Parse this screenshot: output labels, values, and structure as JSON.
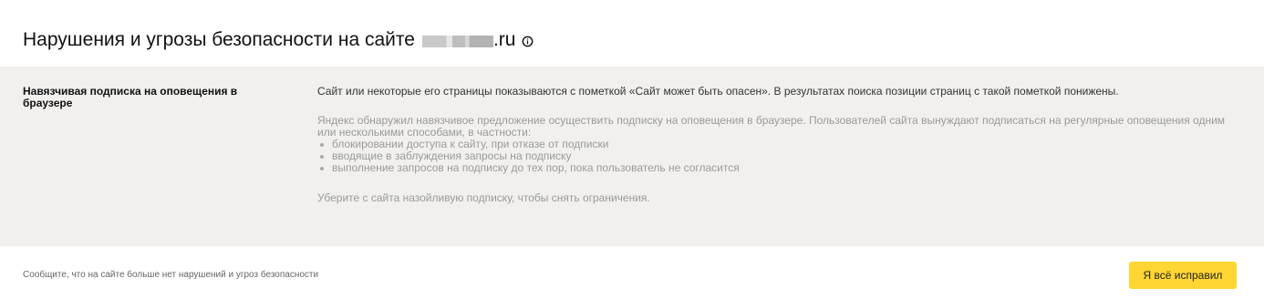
{
  "header": {
    "title_prefix": "Нарушения и угрозы безопасности на сайте",
    "title_suffix": ".ru"
  },
  "violation": {
    "title": "Навязчивая подписка на оповещения в браузере",
    "impact": "Сайт или некоторые его страницы показываются с пометкой «Сайт может быть опасен». В результатах поиска позиции страниц с такой пометкой понижены.",
    "description": "Яндекс обнаружил навязчивое предложение осуществить подписку на оповещения в браузере. Пользователей сайта вынуждают подписаться на регулярные оповещения одним или несколькими способами, в частности:",
    "methods": [
      "блокировании доступа к сайту, при отказе от подписки",
      "вводящие в заблуждения запросы на подписку",
      "выполнение запросов на подписку до тех пор, пока пользователь не согласится"
    ],
    "advice": "Уберите с сайта назойливую подписку, чтобы снять ограничения."
  },
  "footer": {
    "notice": "Сообщите, что на сайте больше нет нарушений и угроз безопасности",
    "button_label": "Я всё исправил"
  },
  "colors": {
    "panel_background": "#f1f0ee",
    "button_background": "#ffd633",
    "muted_text": "#9a9a9a"
  },
  "icons": {
    "info": "info-icon"
  }
}
